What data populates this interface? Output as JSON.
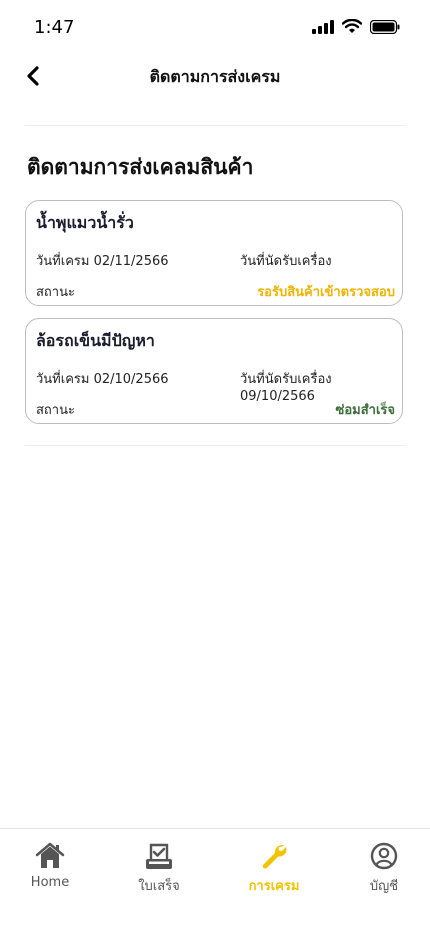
{
  "status_bar": {
    "time": "1:47"
  },
  "header": {
    "title": "ติดตามการส่งเครม"
  },
  "page": {
    "title": "ติดตามการส่งเคลมสินค้า"
  },
  "claims": [
    {
      "product": "น้ำพุแมวน้ำรั่ว",
      "claim_date_label": "วันที่เครม 02/11/2566",
      "appointment_label": "วันที่นัดรับเครื่อง",
      "status_label": "สถานะ",
      "status_value": "รอรับสินค้าเข้าตรวจสอบ",
      "status_color": "#f0b400"
    },
    {
      "product": "ล้อรถเข็นมีปัญหา",
      "claim_date_label": "วันที่เครม 02/10/2566",
      "appointment_label": "วันที่นัดรับเครื่อง 09/10/2566",
      "status_label": "สถานะ",
      "status_value": "ซ่อมสำเร็จ",
      "status_color": "#3c6e3a"
    }
  ],
  "tabbar": {
    "items": [
      {
        "label": "Home",
        "icon": "home-icon"
      },
      {
        "label": "ใบเสร็จ",
        "icon": "receipt-check-icon"
      },
      {
        "label": "การเครม",
        "icon": "wrench-icon",
        "active": true
      },
      {
        "label": "บัญชี",
        "icon": "user-circle-icon"
      }
    ],
    "active_color": "#f2c300"
  }
}
